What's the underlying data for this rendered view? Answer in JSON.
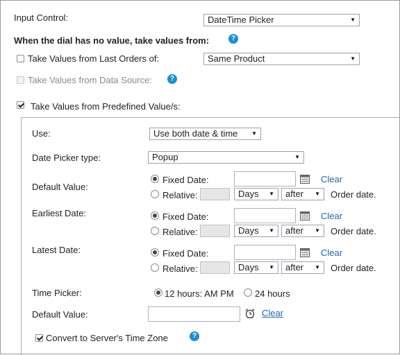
{
  "input_control": {
    "label": "Input Control:",
    "selected": "DateTime Picker"
  },
  "dial_section": {
    "heading": "When the dial has no value, take values from:"
  },
  "last_orders": {
    "label": "Take Values from Last Orders of:",
    "checked": false,
    "selected": "Same Product"
  },
  "data_source": {
    "label": "Take Values from Data Source:",
    "checked": false,
    "disabled": true
  },
  "predefined": {
    "label": "Take Values from Predefined Value/s:",
    "checked": true
  },
  "panel": {
    "use": {
      "label": "Use:",
      "selected": "Use both date & time"
    },
    "date_picker_type": {
      "label": "Date Picker type:",
      "selected": "Popup"
    },
    "default_value": {
      "label": "Default Value:",
      "fixed_label": "Fixed Date:",
      "fixed_value": "",
      "clear_label": "Clear",
      "relative_label": "Relative:",
      "relative_value": "",
      "unit": "Days",
      "direction": "after",
      "suffix": "Order date."
    },
    "earliest_date": {
      "label": "Earliest Date:",
      "fixed_label": "Fixed Date:",
      "fixed_value": "",
      "clear_label": "Clear",
      "relative_label": "Relative:",
      "relative_value": "",
      "unit": "Days",
      "direction": "after",
      "suffix": "Order date."
    },
    "latest_date": {
      "label": "Latest Date:",
      "fixed_label": "Fixed Date:",
      "fixed_value": "",
      "clear_label": "Clear",
      "relative_label": "Relative:",
      "relative_value": "",
      "unit": "Days",
      "direction": "after",
      "suffix": "Order date."
    },
    "time_picker": {
      "label": "Time Picker:",
      "option_12": "12 hours: AM PM",
      "option_24": "24 hours",
      "selected": "12 hours: AM PM"
    },
    "time_default": {
      "label": "Default Value:",
      "value": "",
      "clear_label": "Clear"
    },
    "convert_tz": {
      "label": "Convert to Server's Time Zone",
      "checked": true
    }
  },
  "icons": {
    "help": "help-icon",
    "calendar": "calendar-icon",
    "clock": "alarm-clock-icon",
    "dropdown": "chevron-down-icon"
  },
  "colors": {
    "help_badge": "#1a8fd8",
    "link": "#2264b6",
    "disabled_text": "#8a8a8a",
    "disabled_field": "#e6e6e6"
  }
}
